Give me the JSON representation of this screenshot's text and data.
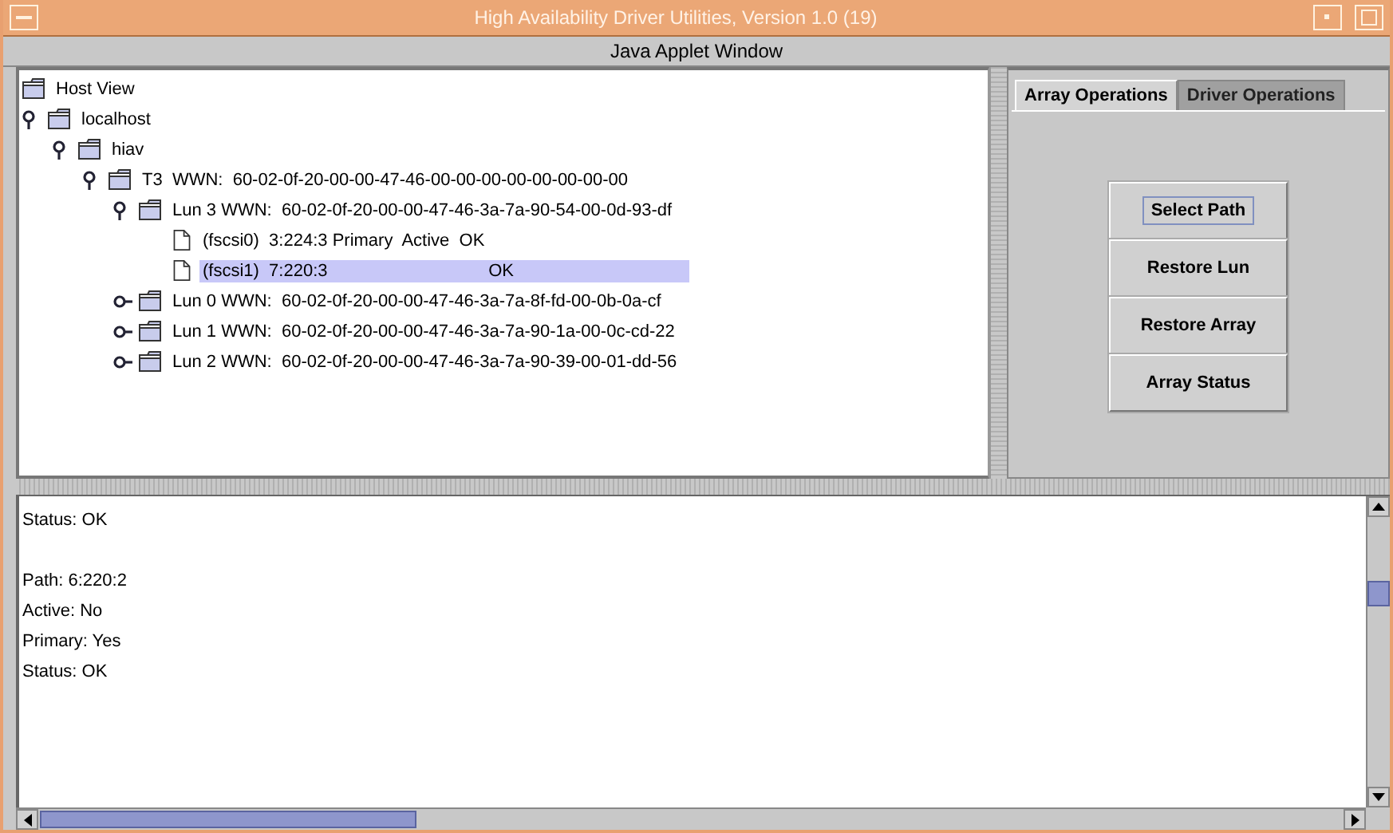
{
  "window": {
    "title": "High Availability Driver Utilities, Version 1.0 (19)",
    "subtitle": "Java Applet Window"
  },
  "tree": [
    {
      "label": "Host View",
      "kind": "folder",
      "selected": false,
      "children": [
        {
          "label": "localhost",
          "kind": "folder",
          "expanded": true,
          "selected": false,
          "children": [
            {
              "label": "hiav",
              "kind": "folder",
              "expanded": true,
              "selected": false,
              "children": [
                {
                  "label": "T3  WWN:  60-02-0f-20-00-00-47-46-00-00-00-00-00-00-00-00",
                  "kind": "folder",
                  "expanded": true,
                  "selected": false,
                  "children": [
                    {
                      "label": "Lun 3 WWN:  60-02-0f-20-00-00-47-46-3a-7a-90-54-00-0d-93-df",
                      "kind": "folder",
                      "expanded": true,
                      "selected": false,
                      "children": [
                        {
                          "label": "(fscsi0)  3:224:3 Primary  Active  OK",
                          "kind": "file",
                          "selected": false
                        },
                        {
                          "label": "(fscsi1)  7:220:3                                 OK",
                          "kind": "file",
                          "selected": true
                        }
                      ]
                    },
                    {
                      "label": "Lun 0 WWN:  60-02-0f-20-00-00-47-46-3a-7a-8f-fd-00-0b-0a-cf",
                      "kind": "folder",
                      "expanded": false,
                      "selected": false
                    },
                    {
                      "label": "Lun 1 WWN:  60-02-0f-20-00-00-47-46-3a-7a-90-1a-00-0c-cd-22",
                      "kind": "folder",
                      "expanded": false,
                      "selected": false
                    },
                    {
                      "label": "Lun 2 WWN:  60-02-0f-20-00-00-47-46-3a-7a-90-39-00-01-dd-56",
                      "kind": "folder",
                      "expanded": false,
                      "selected": false
                    }
                  ]
                }
              ]
            }
          ]
        }
      ]
    }
  ],
  "tabs": [
    {
      "label": "Array Operations",
      "selected": true
    },
    {
      "label": "Driver Operations",
      "selected": false
    }
  ],
  "buttons": [
    {
      "label": "Select Path",
      "focused": true
    },
    {
      "label": "Restore Lun",
      "focused": false
    },
    {
      "label": "Restore Array",
      "focused": false
    },
    {
      "label": "Array Status",
      "focused": false
    }
  ],
  "details": [
    {
      "lines": [
        "Status: OK"
      ]
    },
    {
      "lines": [
        "Path: 6:220:2",
        "Active: No",
        "Primary: Yes",
        "Status: OK"
      ]
    }
  ]
}
